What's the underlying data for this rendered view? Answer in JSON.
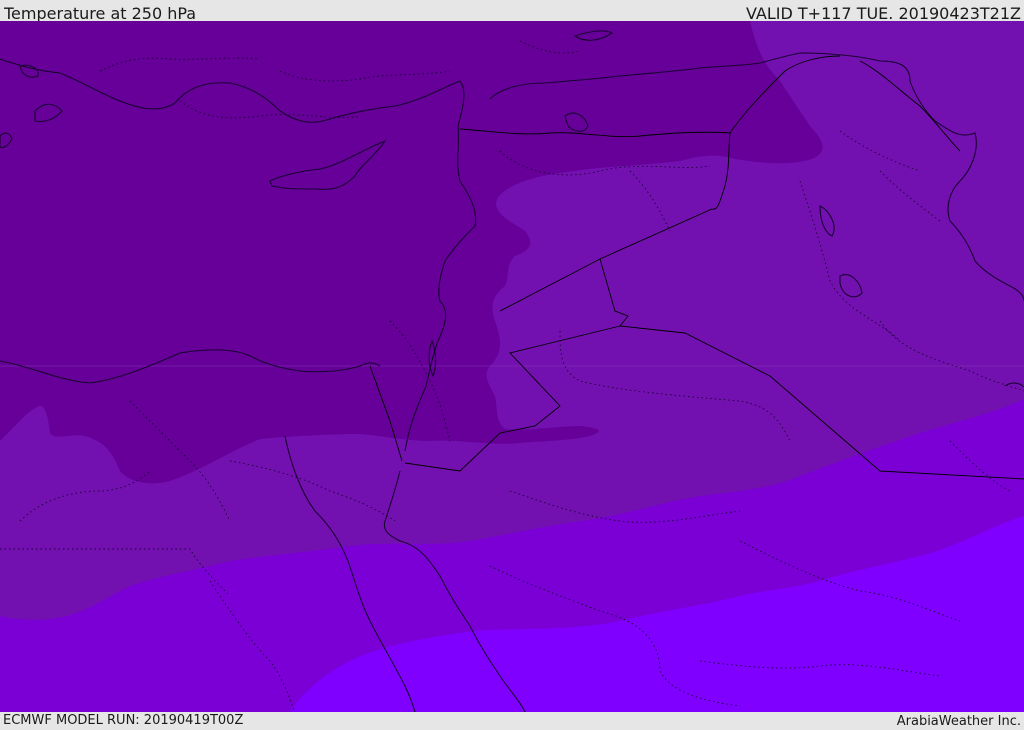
{
  "header": {
    "title": "Temperature at 250 hPa",
    "valid_time": "VALID T+117 TUE. 20190423T21Z"
  },
  "footer": {
    "model_run": "ECMWF MODEL RUN: 20190419T00Z",
    "credit": "ArabiaWeather Inc."
  },
  "map": {
    "region": "Eastern Mediterranean / Middle East",
    "field": "temperature",
    "level_hpa": 250,
    "colors": {
      "band_coldest": "#660099",
      "band_2": "#7311b0",
      "band_3": "#7a00d6",
      "band_warmest": "#7f00ff",
      "coastline": "#1a0033",
      "borders": "#000000"
    }
  }
}
